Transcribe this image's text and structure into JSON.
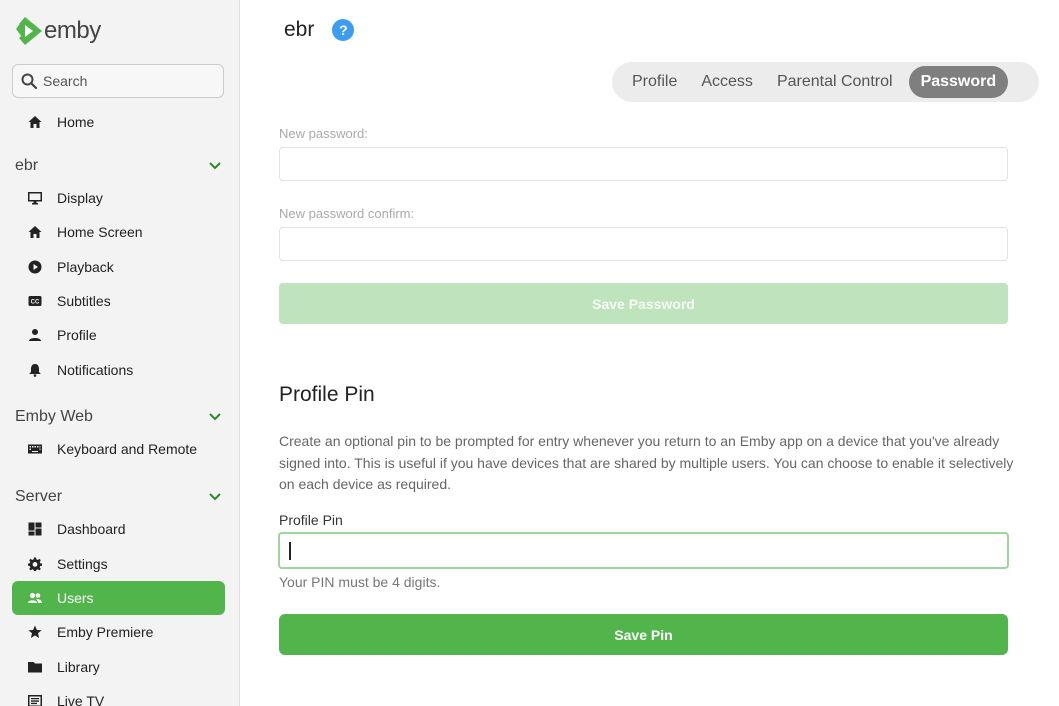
{
  "app": {
    "brand": "emby"
  },
  "search": {
    "placeholder": "Search"
  },
  "sidebar": {
    "home": {
      "label": "Home",
      "icon": "home-icon"
    },
    "sections": [
      {
        "title": "ebr",
        "items": [
          {
            "label": "Display",
            "icon": "monitor-icon"
          },
          {
            "label": "Home Screen",
            "icon": "home-icon"
          },
          {
            "label": "Playback",
            "icon": "play-circle-icon"
          },
          {
            "label": "Subtitles",
            "icon": "closed-caption-icon"
          },
          {
            "label": "Profile",
            "icon": "person-icon"
          },
          {
            "label": "Notifications",
            "icon": "bell-icon"
          }
        ]
      },
      {
        "title": "Emby Web",
        "items": [
          {
            "label": "Keyboard and Remote",
            "icon": "keyboard-icon"
          }
        ]
      },
      {
        "title": "Server",
        "items": [
          {
            "label": "Dashboard",
            "icon": "dashboard-icon"
          },
          {
            "label": "Settings",
            "icon": "gear-icon"
          },
          {
            "label": "Users",
            "icon": "people-icon",
            "active": true
          },
          {
            "label": "Emby Premiere",
            "icon": "star-icon"
          },
          {
            "label": "Library",
            "icon": "folder-icon"
          },
          {
            "label": "Live TV",
            "icon": "tv-guide-icon"
          }
        ]
      }
    ]
  },
  "header": {
    "title": "ebr",
    "help": "?"
  },
  "tabs": [
    {
      "label": "Profile"
    },
    {
      "label": "Access"
    },
    {
      "label": "Parental Control"
    },
    {
      "label": "Password",
      "active": true
    }
  ],
  "password_form": {
    "new_password_label": "New password:",
    "new_password_value": "",
    "confirm_label": "New password confirm:",
    "confirm_value": "",
    "save_label": "Save Password"
  },
  "pin_form": {
    "heading": "Profile Pin",
    "description": "Create an optional pin to be prompted for entry whenever you return to an Emby app on a device that you've already signed into. This is useful if you have devices that are shared by multiple users. You can choose to enable it selectively on each device as required.",
    "field_label": "Profile Pin",
    "value": "",
    "hint": "Your PIN must be 4 digits.",
    "save_label": "Save Pin"
  },
  "colors": {
    "accent": "#52b54b",
    "accent_disabled": "#bfe3bd",
    "help": "#3d9df2"
  }
}
